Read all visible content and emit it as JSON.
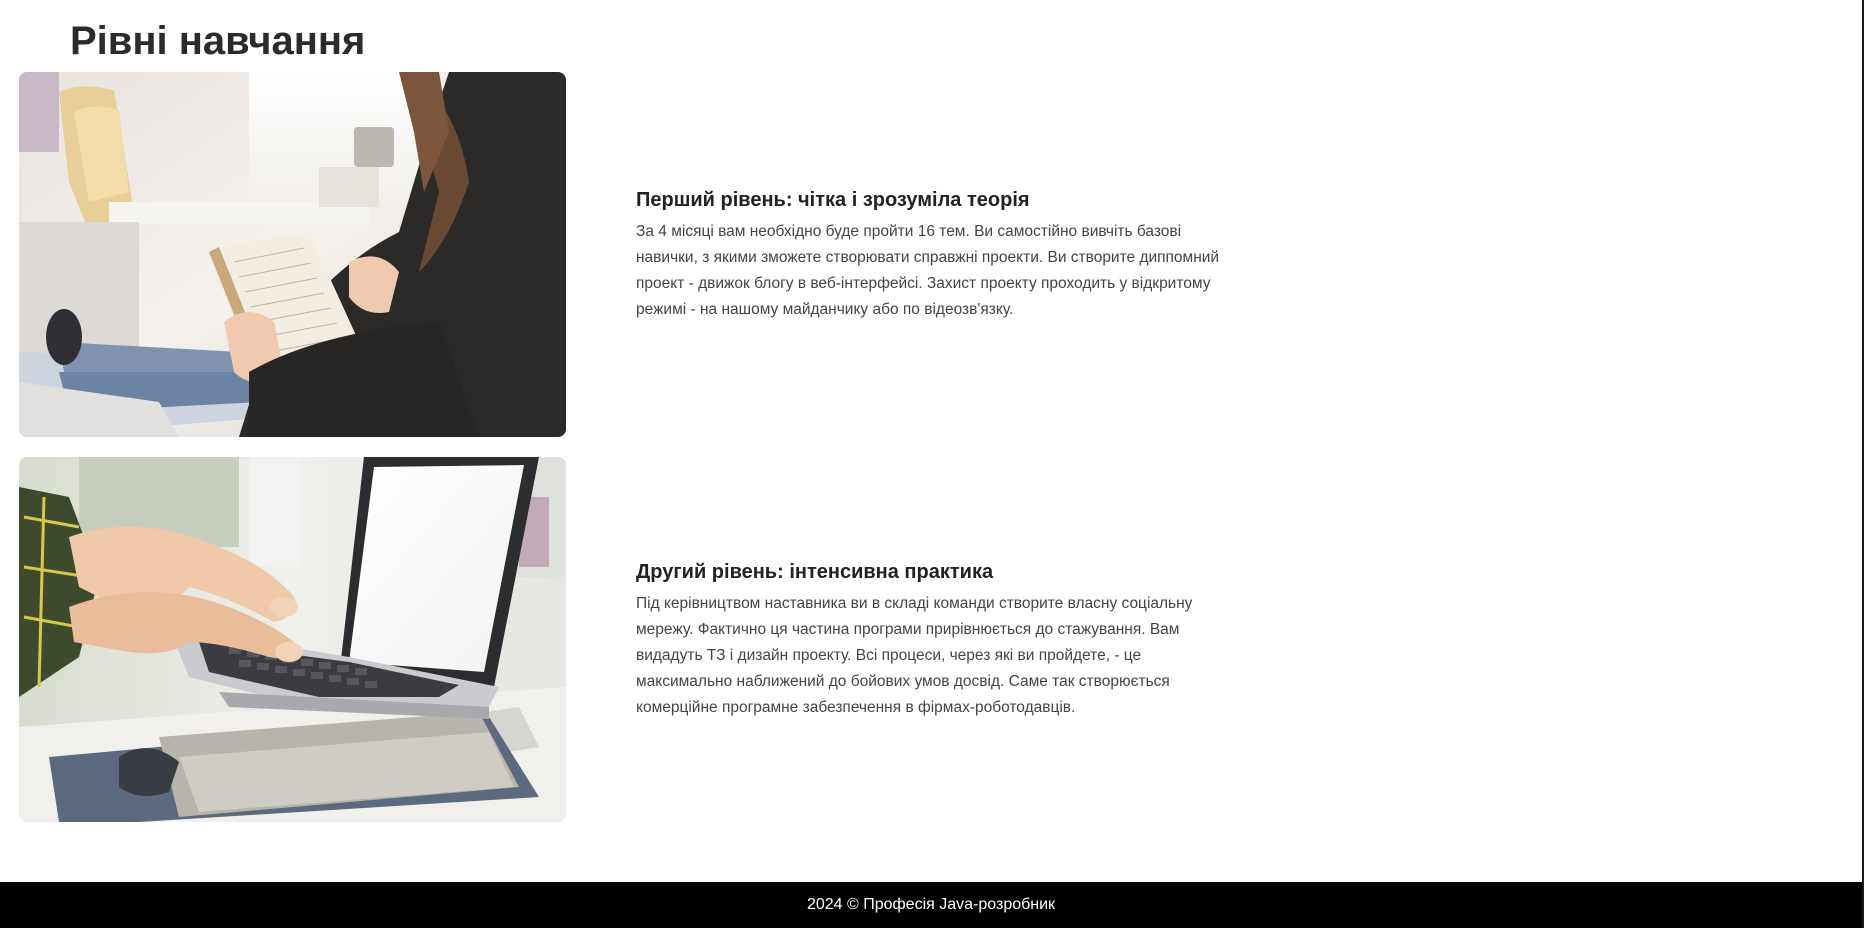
{
  "page": {
    "title": "Рівні навчання"
  },
  "levels": [
    {
      "title": "Перший рівень: чітка і зрозуміла теорія",
      "description": "За 4 місяці вам необхідно буде пройти 16 тем. Ви самостійно вивчіть базові навички, з якими зможете створювати справжні проекти. Ви створите диппомний проект - движок блогу в веб-інтерфейсі. Захист проекту проходить у відкритому режимі - на нашому майданчику або по відеозв'язку.",
      "image": "woman-reading-book-photo"
    },
    {
      "title": "Другий рівень: інтенсивна практика",
      "description": "Під керівництвом наставника ви в складі команди створите власну соціальну мережу. Фактично ця частина програми прирівнюється до стажування. Вам видадуть ТЗ і дизайн проекту. Всі процеси, через які ви пройдете, - це максимально наближений до бойових умов досвід. Саме так створюється комерційне програмне забезпечення в фірмах-роботодавців.",
      "image": "hands-typing-laptop-photo"
    }
  ],
  "footer": {
    "text": "2024 © Професія Java-розробник"
  },
  "colors": {
    "footer_bg": "#000000",
    "footer_text": "#ffffff",
    "heading": "#2b2b2b",
    "body_text": "#444444"
  }
}
